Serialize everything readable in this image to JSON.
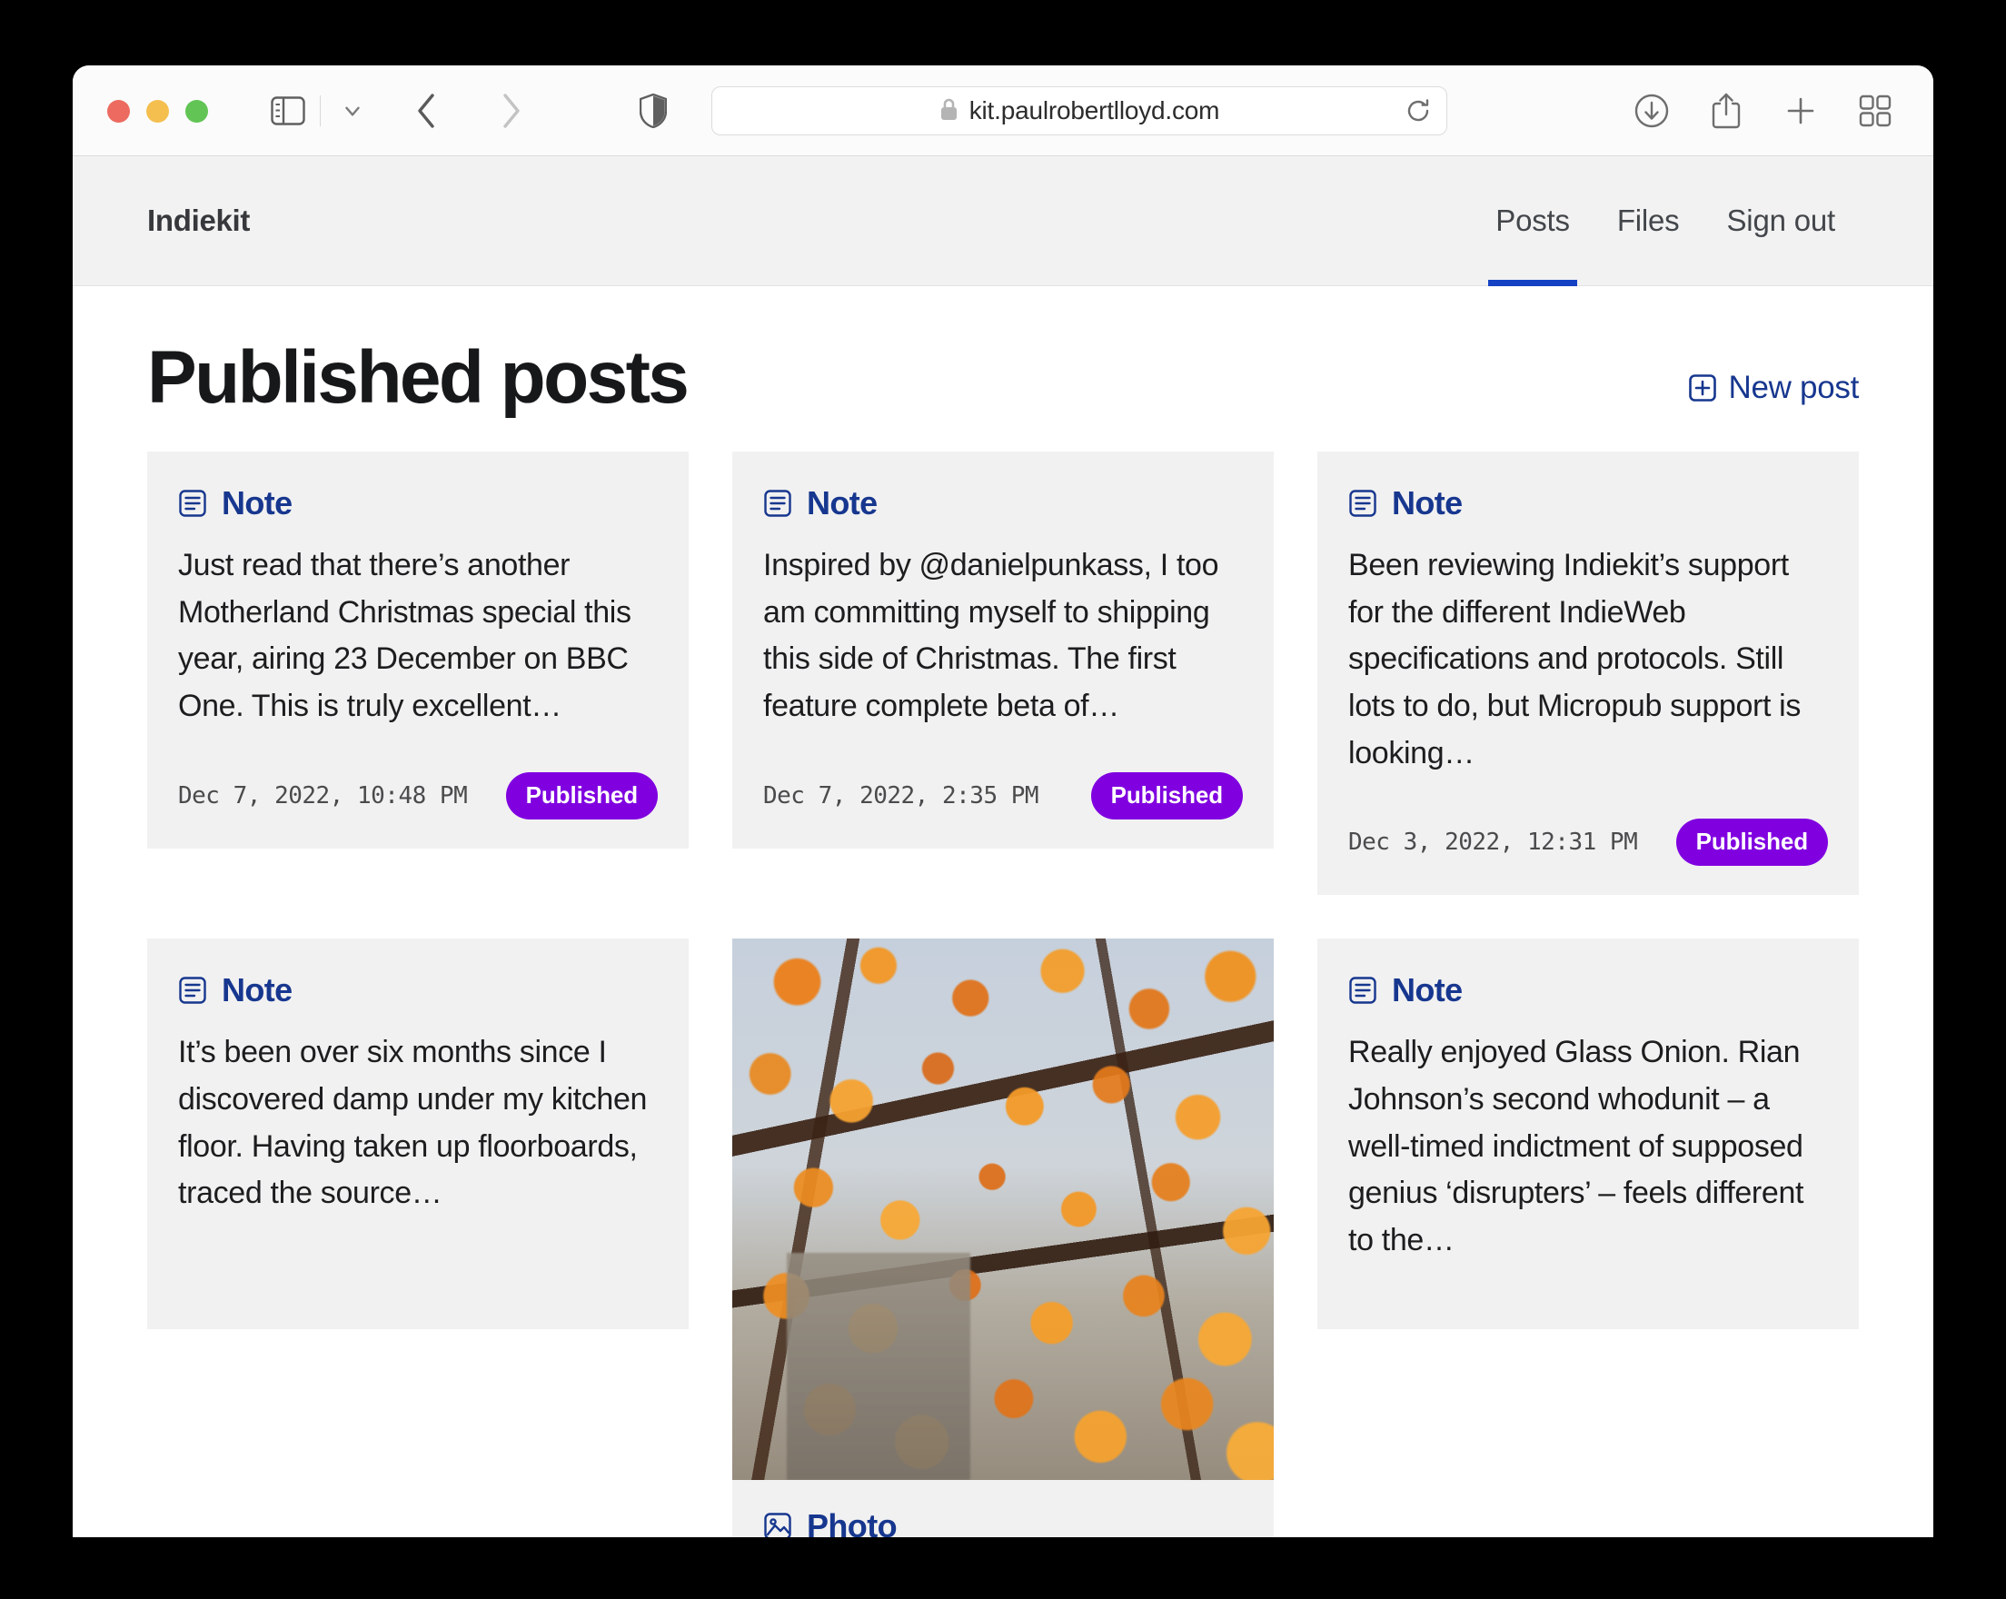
{
  "browser": {
    "url": "kit.paulrobertlloyd.com",
    "toolbar_icons": {
      "sidebar": "sidebar-icon",
      "sidebar_chevron": "chevron-down-icon",
      "back": "back-arrow-icon",
      "forward": "forward-arrow-icon",
      "shield": "privacy-shield-icon",
      "lock": "lock-icon",
      "reload": "reload-icon",
      "downloads": "download-icon",
      "share": "share-icon",
      "new_tab": "plus-icon",
      "tab_overview": "tab-overview-icon"
    }
  },
  "site": {
    "brand": "Indiekit",
    "nav": [
      {
        "label": "Posts",
        "active": true
      },
      {
        "label": "Files",
        "active": false
      },
      {
        "label": "Sign out",
        "active": false
      }
    ]
  },
  "main": {
    "title": "Published posts",
    "new_post_label": "New post",
    "new_post_icon": "plus-square-icon",
    "accent_blue": "#17378f",
    "badge_purple": "#8000e0",
    "active_tab_underline": "#1542c4"
  },
  "posts": [
    {
      "type": "Note",
      "type_icon": "note-icon",
      "excerpt": "Just read that there’s another Motherland Christmas special this year, airing 23 December on BBC One. This is truly excellent…",
      "date": "Dec 7, 2022, 10:48 PM",
      "status": "Published",
      "has_photo": false
    },
    {
      "type": "Note",
      "type_icon": "note-icon",
      "excerpt": "Inspired by @danielpunkass, I too am committing myself to shipping this side of Christmas. The first feature complete beta of…",
      "date": "Dec 7, 2022, 2:35 PM",
      "status": "Published",
      "has_photo": false
    },
    {
      "type": "Note",
      "type_icon": "note-icon",
      "excerpt": "Been reviewing Indiekit’s support for the different IndieWeb specifications and protocols. Still lots to do, but Micropub support is looking…",
      "date": "Dec 3, 2022, 12:31 PM",
      "status": "Published",
      "has_photo": false
    },
    {
      "type": "Note",
      "type_icon": "note-icon",
      "excerpt": "It’s been over six months since I discovered damp under my kitchen floor. Having taken up floorboards, traced the source…",
      "date": "",
      "status": "",
      "has_photo": false
    },
    {
      "type": "Photo",
      "type_icon": "photo-icon",
      "excerpt": "",
      "date": "",
      "status": "",
      "has_photo": true,
      "photo_alt": "Autumn beech tree with orange leaves in front of a stone building"
    },
    {
      "type": "Note",
      "type_icon": "note-icon",
      "excerpt": "Really enjoyed Glass Onion. Rian Johnson’s second whodunit – a well-timed indictment of supposed genius ‘disrupters’ – feels different to the…",
      "date": "",
      "status": "",
      "has_photo": false
    }
  ]
}
